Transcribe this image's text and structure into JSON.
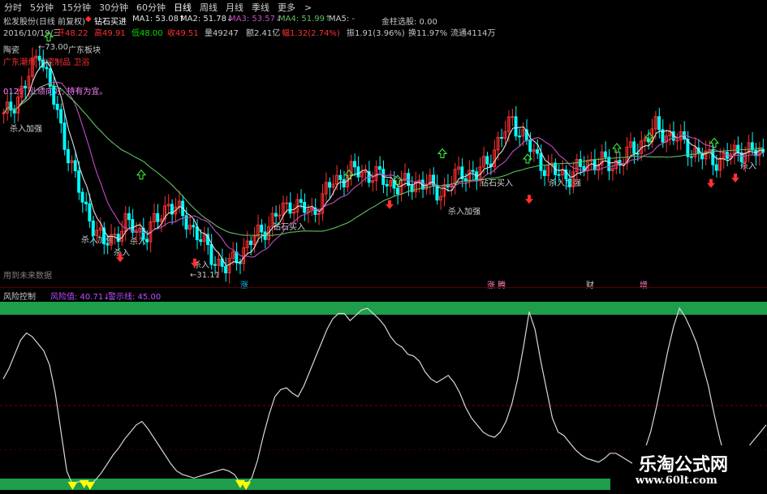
{
  "tabs": [
    {
      "label": "分时"
    },
    {
      "label": "5分钟"
    },
    {
      "label": "15分钟"
    },
    {
      "label": "30分钟"
    },
    {
      "label": "60分钟"
    },
    {
      "label": "日线"
    },
    {
      "label": "周线"
    },
    {
      "label": "月线"
    },
    {
      "label": "季线"
    },
    {
      "label": "更多"
    }
  ],
  "tab_arrow": ">",
  "info": {
    "title": "松发股份(日线 前复权)",
    "signal": "钻石买进",
    "ma1": "MA1: 53.08↑",
    "ma2": "MA2: 51.78↓",
    "ma3": "MA3: 53.57↓",
    "ma4": "MA4: 51.99↑",
    "ma5": "MA5: -",
    "right": "金柱选股: 0.00"
  },
  "stats": {
    "date": "2016/10/19/三",
    "open": "开48.22",
    "high": "高49.91",
    "low": "低48.00",
    "close": "收49.51",
    "vol": "量49247",
    "amt": "额2.41亿",
    "chg": "幅1.32(2.74%)",
    "amp": "振1.91(3.96%)",
    "turn": "换11.97%",
    "float": "流通4114万"
  },
  "labels": {
    "sector_tag": "广东板块",
    "tag1": "陶瓷",
    "tag2": "广东潮州 陶瓷制品 卫浴",
    "tag3": "0129: 业绩向好, 持有为宜。",
    "hi_price": "73.00",
    "lo_price": "31.11",
    "future": "用到未来数据",
    "add_strong": "杀入加强",
    "add": "杀入",
    "buy": "钻石买入",
    "ev1": "涨",
    "ev2": "涨 腾",
    "ev3": "财",
    "ev4": "增"
  },
  "indicator": {
    "name": "风险控制",
    "risk": "风险值: 40.71↓",
    "warn": "警示线: 45.00"
  },
  "watermark": {
    "title": "乐淘公式网",
    "url": "www.60lt.com"
  },
  "colors": {
    "up": "#ff3030",
    "down": "#00ffff",
    "ma_white": "#e0e0e0",
    "ma_purple": "#c050c0",
    "ma_green": "#60c060",
    "ma_pink": "#ff80c0",
    "band": "#1e9e4a",
    "risk_line": "#d8d8d8",
    "arrow_green": "#40ff40",
    "arrow_red": "#ff3030",
    "yellow": "#ffff00"
  },
  "chart_data": {
    "type": "line",
    "title": "风险控制",
    "xlabel": "",
    "ylabel": "",
    "ylim": [
      0,
      100
    ],
    "series": [
      {
        "name": "风险值",
        "values": [
          60,
          66,
          74,
          82,
          86,
          84,
          80,
          76,
          68,
          52,
          30,
          8,
          0,
          2,
          1,
          0,
          3,
          7,
          12,
          17,
          21,
          26,
          30,
          34,
          36,
          32,
          27,
          22,
          17,
          12,
          8,
          6,
          5,
          4,
          5,
          6,
          7,
          8,
          9,
          8,
          6,
          1,
          0,
          4,
          14,
          28,
          40,
          50,
          54,
          55,
          52,
          50,
          56,
          64,
          72,
          80,
          88,
          94,
          97,
          97,
          93,
          96,
          99,
          100,
          97,
          94,
          90,
          84,
          80,
          78,
          74,
          73,
          70,
          64,
          60,
          58,
          60,
          62,
          58,
          52,
          44,
          38,
          34,
          30,
          28,
          27,
          30,
          36,
          46,
          60,
          78,
          98,
          88,
          70,
          54,
          38,
          30,
          28,
          24,
          20,
          17,
          15,
          14,
          13,
          15,
          18,
          18,
          16,
          14,
          12,
          14,
          20,
          30,
          44,
          60,
          76,
          90,
          100,
          95,
          88,
          80,
          68,
          56,
          40,
          26,
          14,
          4,
          6,
          14,
          22,
          26,
          30,
          34
        ]
      }
    ],
    "warning_line": 45.0,
    "last_risk_value": 40.71
  }
}
